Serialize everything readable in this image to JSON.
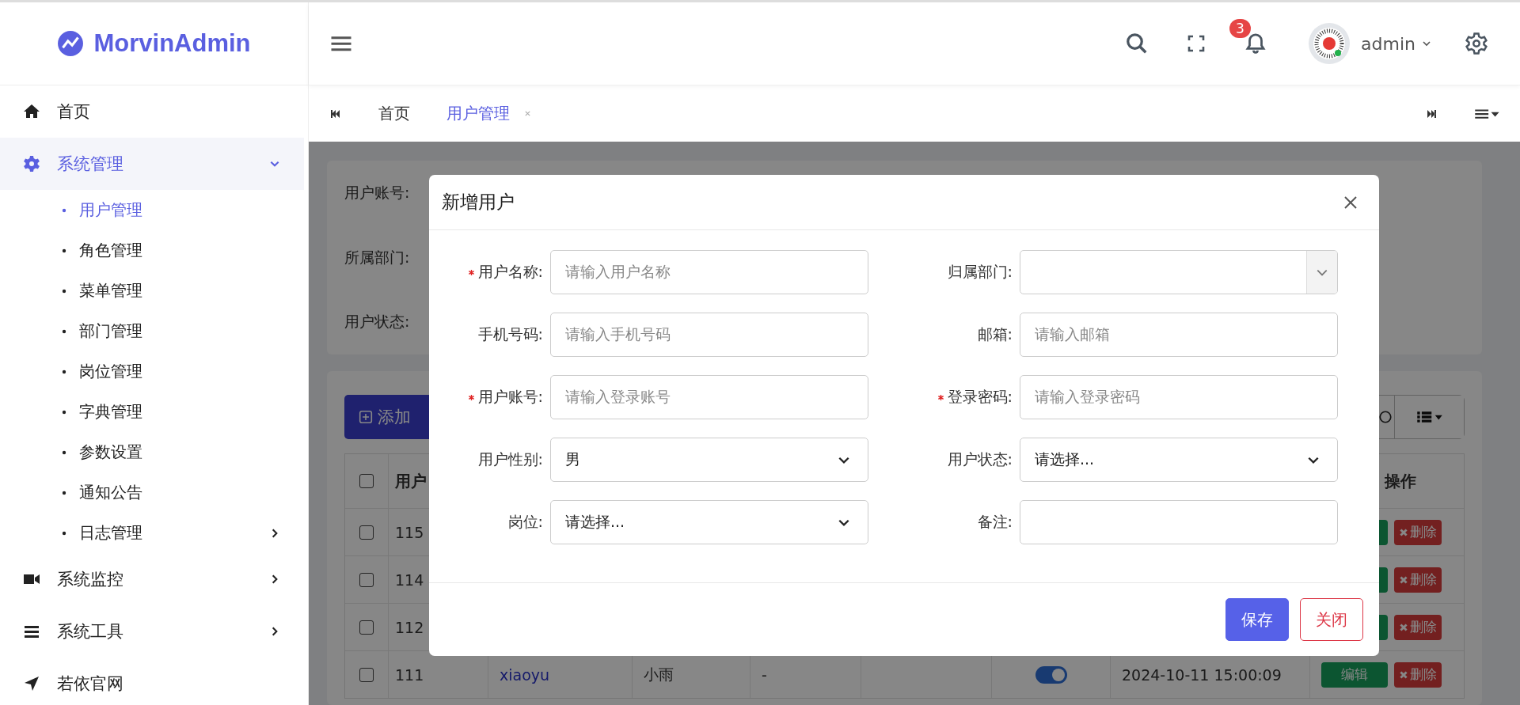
{
  "brand": {
    "name": "MorvinAdmin"
  },
  "sidebar": {
    "items": [
      {
        "label": "首页",
        "selected": false
      },
      {
        "label": "系统管理",
        "selected": true,
        "expanded": true,
        "children": [
          {
            "label": "用户管理",
            "selected": true
          },
          {
            "label": "角色管理",
            "selected": false
          },
          {
            "label": "菜单管理",
            "selected": false
          },
          {
            "label": "部门管理",
            "selected": false
          },
          {
            "label": "岗位管理",
            "selected": false
          },
          {
            "label": "字典管理",
            "selected": false
          },
          {
            "label": "参数设置",
            "selected": false
          },
          {
            "label": "通知公告",
            "selected": false
          },
          {
            "label": "日志管理",
            "selected": false,
            "expanded": false
          }
        ]
      },
      {
        "label": "系统监控",
        "selected": false,
        "expanded": false
      },
      {
        "label": "系统工具",
        "selected": false,
        "expanded": false
      },
      {
        "label": "若依官网",
        "selected": false
      }
    ]
  },
  "header": {
    "notifications": "3",
    "username": "admin"
  },
  "tabs": [
    {
      "label": "首页",
      "selected": false,
      "closable": false
    },
    {
      "label": "用户管理",
      "selected": true,
      "closable": true
    }
  ],
  "search_form": {
    "labels": [
      "用户账号:",
      "所属部门:",
      "用户状态:"
    ]
  },
  "toolbar": {
    "add_button": "添加"
  },
  "table": {
    "select_all_checked": false,
    "columns": [
      "用户",
      "操作"
    ],
    "rows": [
      {
        "checked": false,
        "id": "115",
        "delete": "删除"
      },
      {
        "checked": false,
        "id": "114",
        "delete": "删除"
      },
      {
        "checked": false,
        "id": "112",
        "delete": "删除"
      },
      {
        "checked": false,
        "id": "111",
        "account": "xiaoyu",
        "nickname": "小雨",
        "dept": "-",
        "status_on": true,
        "created": "2024-10-11 15:00:09",
        "edit": "编辑",
        "delete": "删除"
      }
    ]
  },
  "dialog": {
    "title": "新增用户",
    "fields": [
      {
        "label": "用户名称:",
        "required": true,
        "kind": "text",
        "placeholder": "请输入用户名称"
      },
      {
        "label": "归属部门:",
        "required": false,
        "kind": "tree-select"
      },
      {
        "label": "手机号码:",
        "required": false,
        "kind": "text",
        "placeholder": "请输入手机号码"
      },
      {
        "label": "邮箱:",
        "required": false,
        "kind": "text",
        "placeholder": "请输入邮箱"
      },
      {
        "label": "用户账号:",
        "required": true,
        "kind": "text",
        "placeholder": "请输入登录账号"
      },
      {
        "label": "登录密码:",
        "required": true,
        "kind": "text",
        "placeholder": "请输入登录密码"
      },
      {
        "label": "用户性别:",
        "required": false,
        "kind": "select",
        "value": "男"
      },
      {
        "label": "用户状态:",
        "required": false,
        "kind": "select",
        "value": "请选择..."
      },
      {
        "label": "岗位:",
        "required": false,
        "kind": "select",
        "value": "请选择..."
      },
      {
        "label": "备注:",
        "required": false,
        "kind": "text"
      }
    ],
    "buttons": [
      {
        "label": "保存",
        "kind": "primary"
      },
      {
        "label": "关闭",
        "kind": "danger"
      }
    ]
  }
}
